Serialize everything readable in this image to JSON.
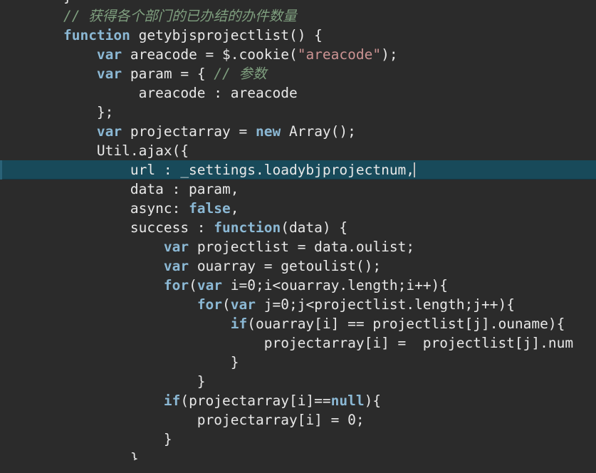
{
  "editor": {
    "name": "code-editor",
    "language": "JavaScript",
    "theme": "Darcula",
    "background_color": "#2b2b2b",
    "default_text_color": "#e8e8e8",
    "keyword_color": "#8bb8d4",
    "string_color": "#cc9393",
    "comment_color": "#7f9f7f",
    "current_line_color": "#184a5a",
    "caret_color": "#bbbbbb",
    "current_line_index": 8
  },
  "code_lines": [
    {
      "indent": 0,
      "current": false,
      "clipped_top": true,
      "tokens": [
        {
          "t": "plain",
          "s": "    }"
        }
      ]
    },
    {
      "indent": 0,
      "current": false,
      "tokens": [
        {
          "t": "cmt",
          "s": "    // 获得各个部门的已办结的办件数量"
        }
      ]
    },
    {
      "indent": 0,
      "current": false,
      "tokens": [
        {
          "t": "plain",
          "s": "    "
        },
        {
          "t": "kw",
          "s": "function"
        },
        {
          "t": "plain",
          "s": " getybjsprojectlist() {"
        }
      ]
    },
    {
      "indent": 0,
      "current": false,
      "tokens": [
        {
          "t": "plain",
          "s": "        "
        },
        {
          "t": "kw",
          "s": "var"
        },
        {
          "t": "plain",
          "s": " areacode = $.cookie("
        },
        {
          "t": "str",
          "s": "\"areacode\""
        },
        {
          "t": "plain",
          "s": ");"
        }
      ]
    },
    {
      "indent": 0,
      "current": false,
      "tokens": [
        {
          "t": "plain",
          "s": "        "
        },
        {
          "t": "kw",
          "s": "var"
        },
        {
          "t": "plain",
          "s": " param = { "
        },
        {
          "t": "cmt",
          "s": "// 参数"
        }
      ]
    },
    {
      "indent": 0,
      "current": false,
      "tokens": [
        {
          "t": "plain",
          "s": "             areacode : areacode"
        }
      ]
    },
    {
      "indent": 0,
      "current": false,
      "tokens": [
        {
          "t": "plain",
          "s": "        };"
        }
      ]
    },
    {
      "indent": 0,
      "current": false,
      "tokens": [
        {
          "t": "plain",
          "s": "        "
        },
        {
          "t": "kw",
          "s": "var"
        },
        {
          "t": "plain",
          "s": " projectarray = "
        },
        {
          "t": "kw",
          "s": "new"
        },
        {
          "t": "plain",
          "s": " Array();"
        }
      ]
    },
    {
      "indent": 0,
      "current": false,
      "tokens": [
        {
          "t": "plain",
          "s": "        Util.ajax({"
        }
      ]
    },
    {
      "indent": 0,
      "current": true,
      "tokens": [
        {
          "t": "plain",
          "s": "            url : _settings.loadybjprojectnum,"
        },
        {
          "t": "caret",
          "s": ""
        }
      ]
    },
    {
      "indent": 0,
      "current": false,
      "tokens": [
        {
          "t": "plain",
          "s": "            data : param,"
        }
      ]
    },
    {
      "indent": 0,
      "current": false,
      "tokens": [
        {
          "t": "plain",
          "s": "            async: "
        },
        {
          "t": "kw",
          "s": "false"
        },
        {
          "t": "plain",
          "s": ","
        }
      ]
    },
    {
      "indent": 0,
      "current": false,
      "tokens": [
        {
          "t": "plain",
          "s": "            success : "
        },
        {
          "t": "kw",
          "s": "function"
        },
        {
          "t": "plain",
          "s": "(data) {"
        }
      ]
    },
    {
      "indent": 0,
      "current": false,
      "tokens": [
        {
          "t": "plain",
          "s": "                "
        },
        {
          "t": "kw",
          "s": "var"
        },
        {
          "t": "plain",
          "s": " projectlist = data.oulist;"
        }
      ]
    },
    {
      "indent": 0,
      "current": false,
      "tokens": [
        {
          "t": "plain",
          "s": "                "
        },
        {
          "t": "kw",
          "s": "var"
        },
        {
          "t": "plain",
          "s": " ouarray = getoulist();"
        }
      ]
    },
    {
      "indent": 0,
      "current": false,
      "tokens": [
        {
          "t": "plain",
          "s": "                "
        },
        {
          "t": "kw",
          "s": "for"
        },
        {
          "t": "plain",
          "s": "("
        },
        {
          "t": "kw",
          "s": "var"
        },
        {
          "t": "plain",
          "s": " i=0;i<ouarray.length;i++){"
        }
      ]
    },
    {
      "indent": 0,
      "current": false,
      "tokens": [
        {
          "t": "plain",
          "s": "                    "
        },
        {
          "t": "kw",
          "s": "for"
        },
        {
          "t": "plain",
          "s": "("
        },
        {
          "t": "kw",
          "s": "var"
        },
        {
          "t": "plain",
          "s": " j=0;j<projectlist.length;j++){"
        }
      ]
    },
    {
      "indent": 0,
      "current": false,
      "tokens": [
        {
          "t": "plain",
          "s": "                        "
        },
        {
          "t": "kw",
          "s": "if"
        },
        {
          "t": "plain",
          "s": "(ouarray[i] == projectlist[j].ouname){"
        }
      ]
    },
    {
      "indent": 0,
      "current": false,
      "tokens": [
        {
          "t": "plain",
          "s": "                            projectarray[i] =  projectlist[j].num"
        }
      ]
    },
    {
      "indent": 0,
      "current": false,
      "tokens": [
        {
          "t": "plain",
          "s": "                        }"
        }
      ]
    },
    {
      "indent": 0,
      "current": false,
      "tokens": [
        {
          "t": "plain",
          "s": "                    }"
        }
      ]
    },
    {
      "indent": 0,
      "current": false,
      "tokens": [
        {
          "t": "plain",
          "s": "                "
        },
        {
          "t": "kw",
          "s": "if"
        },
        {
          "t": "plain",
          "s": "(projectarray[i]=="
        },
        {
          "t": "kw",
          "s": "null"
        },
        {
          "t": "plain",
          "s": "){"
        }
      ]
    },
    {
      "indent": 0,
      "current": false,
      "tokens": [
        {
          "t": "plain",
          "s": "                    projectarray[i] = 0;"
        }
      ]
    },
    {
      "indent": 0,
      "current": false,
      "tokens": [
        {
          "t": "plain",
          "s": "                }"
        }
      ]
    },
    {
      "indent": 0,
      "current": false,
      "tokens": [
        {
          "t": "plain",
          "s": "            }"
        }
      ]
    }
  ]
}
